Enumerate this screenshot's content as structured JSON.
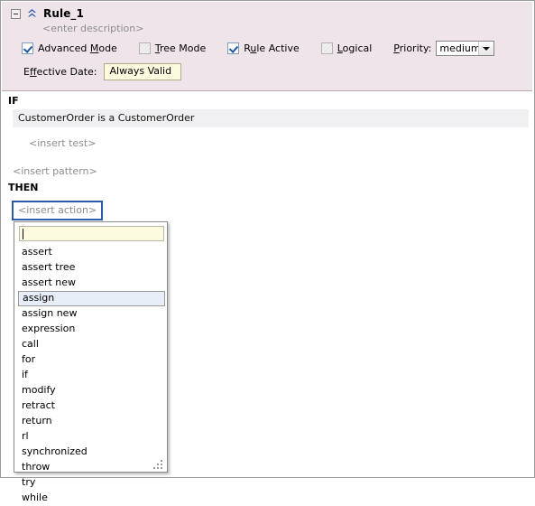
{
  "rule": {
    "expander_icon": "collapse-minus-icon",
    "chevron_icon": "chevron-double-up-icon",
    "name": "Rule_1",
    "description": "<enter description>",
    "options": [
      {
        "id": "advanced-mode",
        "label_pre": "Advanced ",
        "label_mnemonic": "M",
        "label_post": "ode",
        "checked": true,
        "disabled": false
      },
      {
        "id": "tree-mode",
        "label_pre": "",
        "label_mnemonic": "T",
        "label_post": "ree Mode",
        "checked": false,
        "disabled": true
      },
      {
        "id": "rule-active",
        "label_pre": "R",
        "label_mnemonic": "u",
        "label_post": "le Active",
        "checked": true,
        "disabled": false
      },
      {
        "id": "logical",
        "label_pre": "",
        "label_mnemonic": "L",
        "label_post": "ogical",
        "checked": false,
        "disabled": true
      }
    ],
    "priority": {
      "label_mnemonic": "P",
      "label_post": "riority:",
      "value": "medium",
      "options": [
        "medium"
      ]
    },
    "effective_date": {
      "label_mnemonic": "f",
      "label_pre": "E",
      "label_post": "fective Date:",
      "value": "Always Valid"
    }
  },
  "body": {
    "if_keyword": "IF",
    "pattern_text": "CustomerOrder is a CustomerOrder",
    "insert_test": "<insert test>",
    "insert_pattern": "<insert pattern>",
    "then_keyword": "THEN",
    "insert_action": "<insert action>"
  },
  "popup": {
    "input_value": "",
    "selected": "assign",
    "items": [
      "assert",
      "assert tree",
      "assert new",
      "assign",
      "assign new",
      "expression",
      "call",
      "for",
      "if",
      "modify",
      "retract",
      "return",
      "rl",
      "synchronized",
      "throw",
      "try",
      "while"
    ],
    "resize_grip_icon": "resize-grip-icon"
  },
  "colors": {
    "panel_bg": "#efe4ea",
    "pattern_bg": "#f0f0f2",
    "focus_border": "#2a5caa",
    "field_yellow": "#fcfbe0",
    "selection_bg": "#e8eef8",
    "placeholder_text": "#8d8d8d"
  }
}
